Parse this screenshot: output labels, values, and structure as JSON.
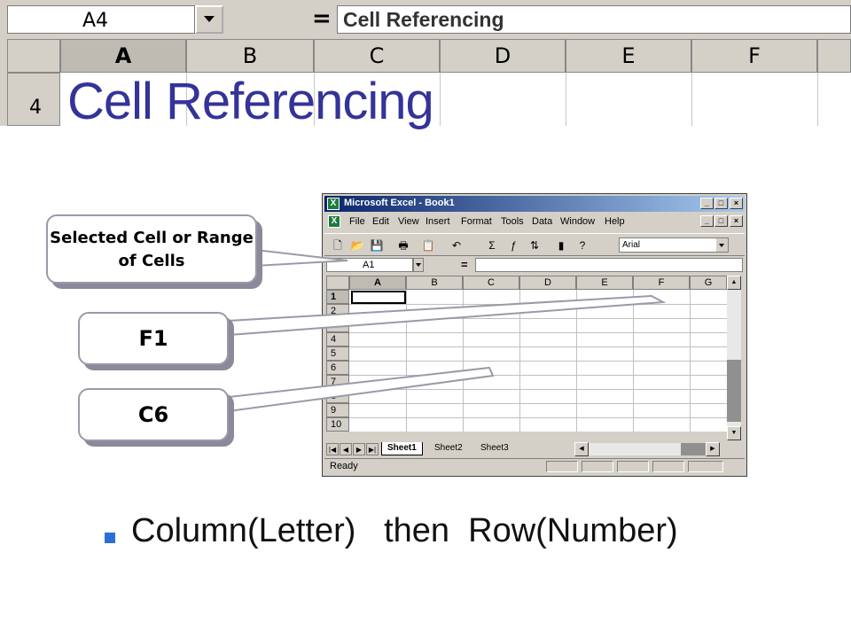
{
  "top_header": {
    "namebox": "A4",
    "equals": "=",
    "formula": "Cell Referencing",
    "columns": [
      "A",
      "B",
      "C",
      "D",
      "E",
      "F"
    ],
    "row_number": "4"
  },
  "title": "Cell Referencing",
  "excel": {
    "window_title": "Microsoft Excel - Book1",
    "menu": [
      "File",
      "Edit",
      "View",
      "Insert",
      "Format",
      "Tools",
      "Data",
      "Window",
      "Help"
    ],
    "font_name": "Arial",
    "name_box": "A1",
    "equals": "=",
    "columns": [
      "A",
      "B",
      "C",
      "D",
      "E",
      "F",
      "G"
    ],
    "rows": [
      "1",
      "2",
      "3",
      "4",
      "5",
      "6",
      "7",
      "8",
      "9",
      "10"
    ],
    "sheet_tabs": [
      "Sheet1",
      "Sheet2",
      "Sheet3"
    ],
    "status": "Ready"
  },
  "callouts": {
    "selected": "Selected Cell or Range of Cells",
    "f1": "F1",
    "c6": "C6"
  },
  "bullet_text": "Column(Letter)   then  Row(Number)",
  "colors": {
    "title": "#333399",
    "bullet": "#2b6fd6",
    "title_bar": "#0a246a"
  },
  "icons": [
    "dropdown-arrow-icon",
    "excel-logo-icon",
    "minimize-icon",
    "maximize-icon",
    "close-icon",
    "new-icon",
    "open-icon",
    "save-icon",
    "print-icon",
    "paste-icon",
    "undo-icon",
    "sum-icon",
    "function-icon",
    "sort-icon",
    "chart-icon",
    "help-icon",
    "bullet-square-icon"
  ]
}
